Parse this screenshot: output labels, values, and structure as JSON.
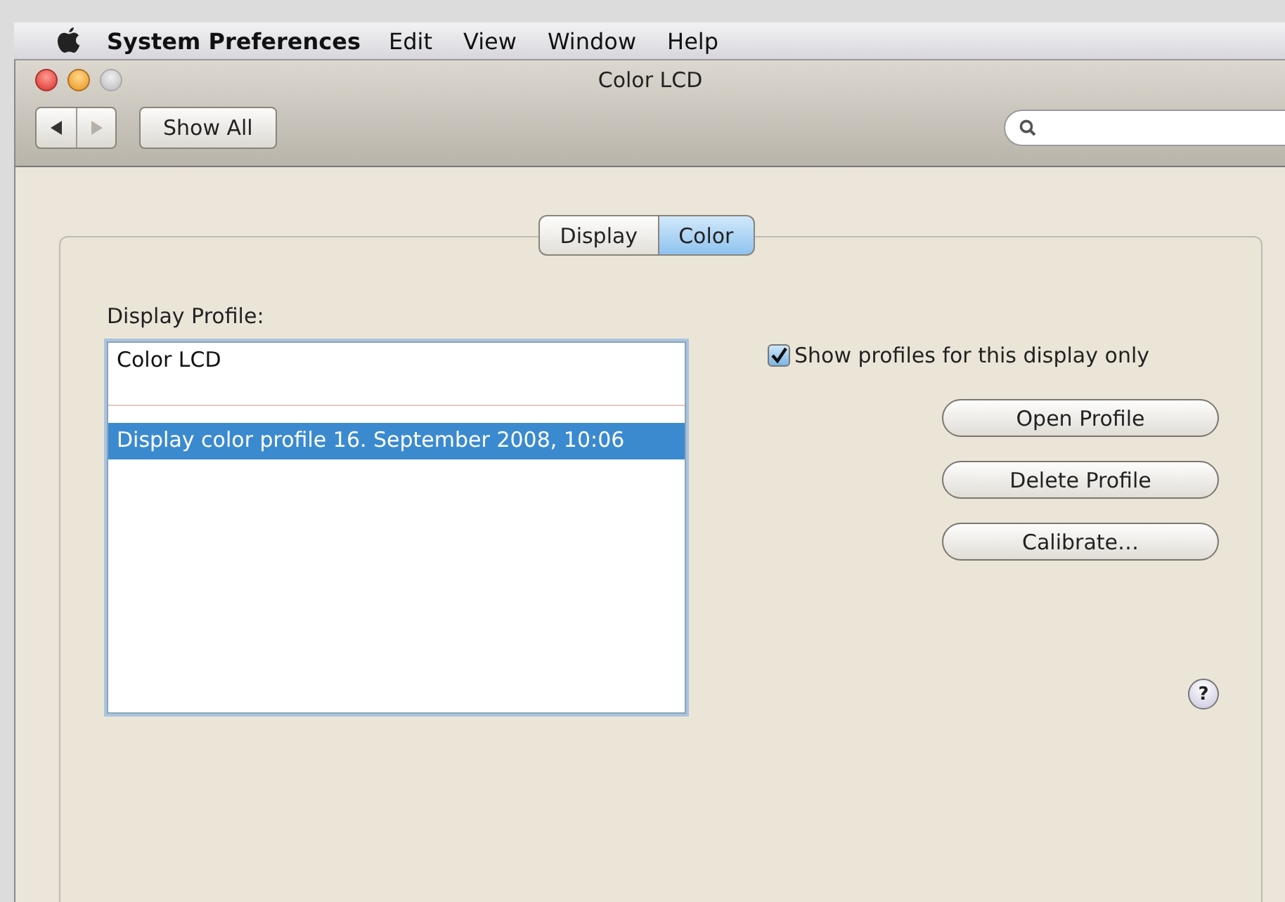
{
  "menu_bar": {
    "app_name": "System Preferences",
    "menus": [
      "Edit",
      "View",
      "Window",
      "Help"
    ]
  },
  "window": {
    "title": "Color LCD"
  },
  "toolbar": {
    "back": {
      "disabled": false
    },
    "forward": {
      "disabled": true
    },
    "show_all": "Show All"
  },
  "tabs": [
    {
      "label": "Display",
      "selected": false
    },
    {
      "label": "Color",
      "selected": true
    }
  ],
  "profile_label": "Display Profile:",
  "profiles": [
    {
      "label": "Color LCD",
      "selected": false
    },
    {
      "label": "Display color profile 16. September 2008, 10:06",
      "selected": true
    }
  ],
  "filter_checkbox": {
    "label": "Show profiles for this display only",
    "checked": true
  },
  "buttons": [
    "Open Profile",
    "Delete Profile",
    "Calibrate…"
  ],
  "help": "?"
}
